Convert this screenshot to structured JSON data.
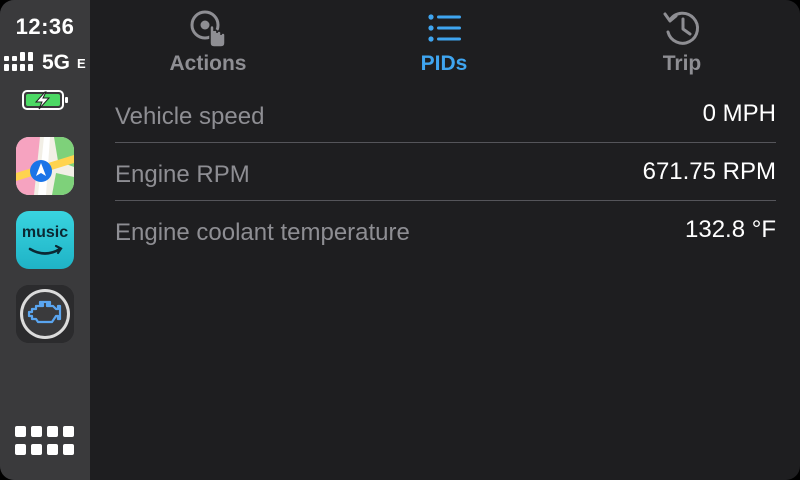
{
  "status": {
    "time": "12:36",
    "network": "5G",
    "network_suffix": "E",
    "battery": "charging"
  },
  "dock": {
    "apps": [
      {
        "name": "Maps",
        "icon": "maps-icon"
      },
      {
        "name": "Amazon Music",
        "label": "music",
        "icon": "amazon-music-icon"
      },
      {
        "name": "OBD",
        "icon": "check-engine-icon"
      }
    ],
    "launcher_icon": "app-grid-icon"
  },
  "tabs": [
    {
      "label": "Actions",
      "icon": "tap-action-icon",
      "active": false
    },
    {
      "label": "PIDs",
      "icon": "list-icon",
      "active": true
    },
    {
      "label": "Trip",
      "icon": "history-icon",
      "active": false
    }
  ],
  "pids": [
    {
      "name": "Vehicle speed",
      "value": "0 MPH"
    },
    {
      "name": "Engine RPM",
      "value": "671.75 RPM"
    },
    {
      "name": "Engine coolant temperature",
      "value": "132.8 °F"
    }
  ],
  "colors": {
    "accent": "#3fa5f0",
    "background": "#1e1e20",
    "sidebar": "#3a3a3c",
    "muted_text": "#8e8e93",
    "divider": "#55555a"
  }
}
